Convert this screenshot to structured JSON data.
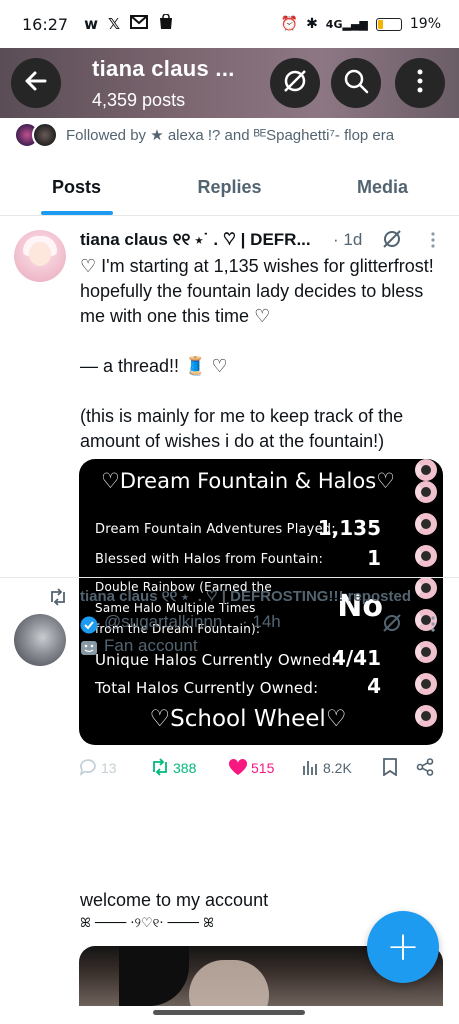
{
  "status_bar": {
    "time": "16:27",
    "app_icons": [
      "w",
      "X",
      "M",
      "bag"
    ],
    "right_icons": [
      "alarm",
      "bluetooth",
      "signal",
      "battery"
    ],
    "signal_label": "4G",
    "battery": "19%"
  },
  "header": {
    "title": "tiana claus ...",
    "post_count": "4,359 posts",
    "buttons": [
      "back-arrow-icon",
      "grok-icon",
      "search-icon",
      "more-vertical-icon"
    ]
  },
  "followed_by": {
    "text": "Followed by ★ alexa !? and ᴮᴱSpaghetti⁷- flop era"
  },
  "tabs": [
    {
      "label": "Posts",
      "active": true
    },
    {
      "label": "Replies",
      "active": false
    },
    {
      "label": "Media",
      "active": false
    }
  ],
  "post1": {
    "author": "tiana claus ୧୧ ⋆˙ . ♡ | DEFR...",
    "time": "· 1d",
    "text": "♡ I'm starting at 1,135 wishes for glitterfrost! hopefully the fountain lady decides to bless me with one this time ♡\n\n— a thread!! 🧵 ♡\n\n(this is mainly for me to keep track of the amount of wishes i do at the fountain!)",
    "card": {
      "title": "♡Dream Fountain & Halos♡",
      "rows": [
        {
          "label": "Dream Fountain Adventures Played:",
          "value": "1,135"
        },
        {
          "label": "Blessed with Halos from Fountain:",
          "value": "1"
        },
        {
          "label": "Double Rainbow (Earned the\nSame Halo Multiple Times\nfrom the Dream Fountain):",
          "value": "No"
        },
        {
          "label": "Unique Halos Currently Owned:",
          "value": "4/41"
        },
        {
          "label": "Total Halos Currently Owned:",
          "value": "4"
        }
      ],
      "footer": "♡School Wheel♡"
    },
    "stats": {
      "replies": "13",
      "reposts": "388",
      "likes": "515",
      "views": "8.2K"
    },
    "colors": {
      "repost": "#00ba7c",
      "like": "#f91880"
    }
  },
  "post2": {
    "repost_label": "tiana claus ୧୧ ⋆˙ . ♡ | DEFROSTING!!! reposted",
    "handle": "@sugartalkinnn",
    "time": "· 14h",
    "account_type": "Fan account",
    "text": "welcome to my account",
    "deco": "ꕤ ──── ·୨♡୧· ──── ꕤ"
  },
  "fab": {
    "label": "+"
  },
  "accent": "#1d9bf0"
}
